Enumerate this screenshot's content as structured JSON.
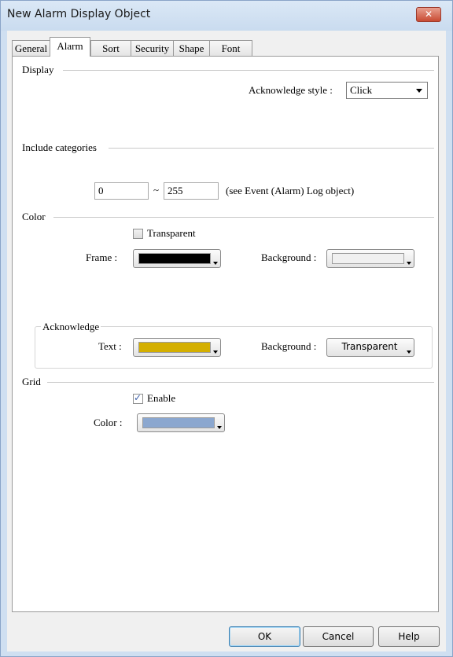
{
  "window": {
    "title": "New Alarm Display Object",
    "close_glyph": "✕"
  },
  "tabs": [
    {
      "label": "General"
    },
    {
      "label": "Alarm",
      "active": true
    },
    {
      "label": "Sort"
    },
    {
      "label": "Security"
    },
    {
      "label": "Shape"
    },
    {
      "label": "Font"
    }
  ],
  "display": {
    "group_label": "Display",
    "ack_style_label": "Acknowledge style :",
    "ack_style_value": "Click"
  },
  "categories": {
    "group_label": "Include categories",
    "from_value": "0",
    "separator": "~",
    "to_value": "255",
    "note": "(see Event (Alarm) Log object)"
  },
  "color": {
    "group_label": "Color",
    "transparent_label": "Transparent",
    "transparent_checked": false,
    "frame_label": "Frame :",
    "frame_color": "#000000",
    "background_label": "Background :",
    "background_color": "#f0f0f0"
  },
  "acknowledge": {
    "group_label": "Acknowledge",
    "text_label": "Text :",
    "text_color": "#d4af00",
    "background_label": "Background :",
    "background_value": "Transparent"
  },
  "grid": {
    "group_label": "Grid",
    "enable_label": "Enable",
    "enable_checked": true,
    "color_label": "Color :",
    "color_value": "#8ba7cf"
  },
  "buttons": {
    "ok": "OK",
    "cancel": "Cancel",
    "help": "Help"
  }
}
